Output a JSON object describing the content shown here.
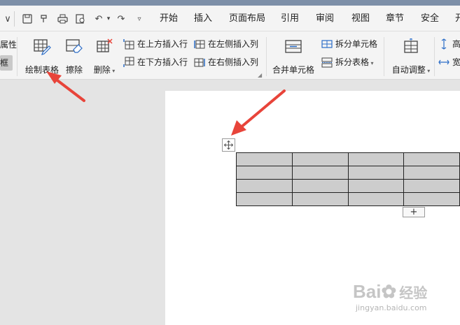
{
  "menu": {
    "tabs": [
      "开始",
      "插入",
      "页面布局",
      "引用",
      "审阅",
      "视图",
      "章节",
      "安全",
      "开"
    ]
  },
  "left_panel": {
    "item1": "属性",
    "item2": "框"
  },
  "ribbon": {
    "draw_table": "绘制表格",
    "erase": "擦除",
    "delete": "删除",
    "insert_row_above": "在上方插入行",
    "insert_row_below": "在下方插入行",
    "insert_col_left": "在左侧插入列",
    "insert_col_right": "在右侧插入列",
    "merge_cells": "合并单元格",
    "split_cells": "拆分单元格",
    "split_table": "拆分表格",
    "auto_fit": "自动调整",
    "height": "高",
    "width": "宽"
  },
  "table": {
    "rows": 4,
    "cols": 4
  },
  "add_row_label": "+",
  "watermark": {
    "brand": "Bai",
    "brand2": "经验",
    "url": "jingyan.baidu.com"
  },
  "colors": {
    "accent_arrow": "#e8443a",
    "title_bar": "#7d8fa8",
    "table_fill": "#cdcdcd"
  }
}
